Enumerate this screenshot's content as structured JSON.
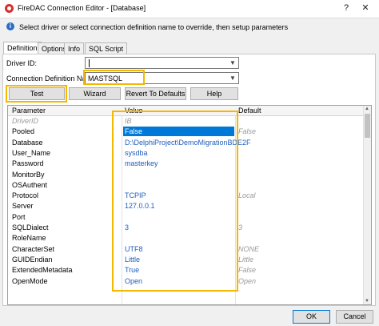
{
  "window": {
    "title": "FireDAC Connection Editor - [Database]",
    "help_glyph": "?",
    "close_glyph": "✕",
    "app_icon": "firedac-icon"
  },
  "info": {
    "text": "Select driver or select connection definition name to override, then setup parameters",
    "icon": "info-icon"
  },
  "tabs": [
    "Definition",
    "Options",
    "Info",
    "SQL Script"
  ],
  "active_tab": "Definition",
  "form": {
    "driver_label": "Driver ID:",
    "driver_value": "",
    "conn_def_label": "Connection Definition Name:",
    "conn_def_value": "MASTSQL"
  },
  "buttons": {
    "test": "Test",
    "wizard": "Wizard",
    "revert": "Revert To Defaults",
    "help": "Help"
  },
  "grid": {
    "headers": [
      "Parameter",
      "Value",
      "Default"
    ],
    "rows": [
      {
        "name": "DriverID",
        "value": "IB",
        "default": "",
        "style": "gray"
      },
      {
        "name": "Pooled",
        "value": "False",
        "default": "False",
        "style": "sel"
      },
      {
        "name": "Database",
        "value": "D:\\DelphiProject\\DemoMigrationBDE2F",
        "default": "",
        "style": ""
      },
      {
        "name": "User_Name",
        "value": "sysdba",
        "default": "",
        "style": ""
      },
      {
        "name": "Password",
        "value": "masterkey",
        "default": "",
        "style": ""
      },
      {
        "name": "MonitorBy",
        "value": "",
        "default": "",
        "style": ""
      },
      {
        "name": "OSAuthent",
        "value": "",
        "default": "",
        "style": ""
      },
      {
        "name": "Protocol",
        "value": "TCPIP",
        "default": "Local",
        "style": ""
      },
      {
        "name": "Server",
        "value": "127.0.0.1",
        "default": "",
        "style": ""
      },
      {
        "name": "Port",
        "value": "",
        "default": "",
        "style": ""
      },
      {
        "name": "SQLDialect",
        "value": "3",
        "default": "3",
        "style": ""
      },
      {
        "name": "RoleName",
        "value": "",
        "default": "",
        "style": ""
      },
      {
        "name": "CharacterSet",
        "value": "UTF8",
        "default": "NONE",
        "style": ""
      },
      {
        "name": "GUIDEndian",
        "value": "Little",
        "default": "Little",
        "style": ""
      },
      {
        "name": "ExtendedMetadata",
        "value": "True",
        "default": "False",
        "style": ""
      },
      {
        "name": "OpenMode",
        "value": "Open",
        "default": "Open",
        "style": ""
      }
    ]
  },
  "footer": {
    "ok": "OK",
    "cancel": "Cancel"
  },
  "colors": {
    "highlight": "#f5b800",
    "selection": "#0078d7",
    "value_text": "#1f5dbd"
  }
}
